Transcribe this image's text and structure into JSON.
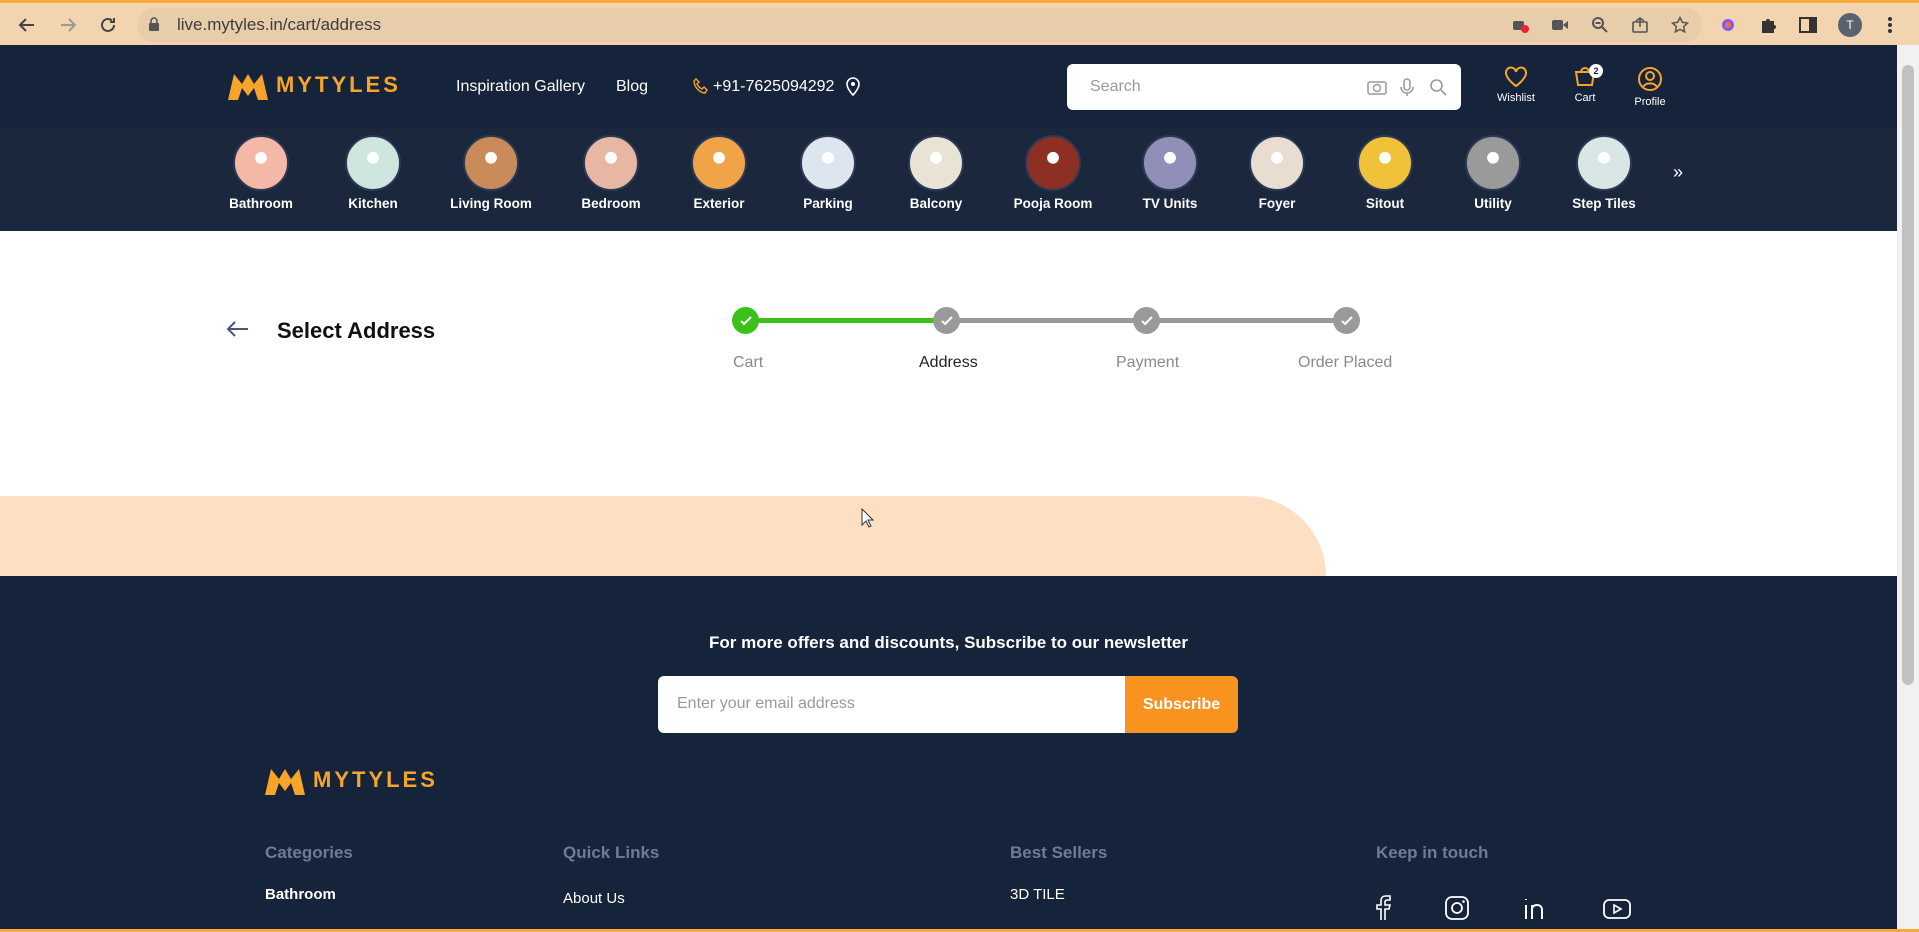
{
  "browser": {
    "url": "live.mytyles.in/cart/address",
    "profile_initial": "T"
  },
  "brand": {
    "name": "MYTYLES",
    "color": "#f7a52a"
  },
  "header": {
    "nav": {
      "inspiration": "Inspiration Gallery",
      "blog": "Blog",
      "phone": "+91-7625094292"
    },
    "search_placeholder": "Search",
    "wishlist": "Wishlist",
    "cart": "Cart",
    "cart_count": "2",
    "profile": "Profile"
  },
  "categories": [
    "Bathroom",
    "Kitchen",
    "Living Room",
    "Bedroom",
    "Exterior",
    "Parking",
    "Balcony",
    "Pooja Room",
    "TV Units",
    "Foyer",
    "Sitout",
    "Utility",
    "Step Tiles"
  ],
  "more_glyph": "»",
  "page": {
    "title": "Select Address",
    "steps": [
      "Cart",
      "Address",
      "Payment",
      "Order Placed"
    ]
  },
  "footer": {
    "newsletter": "For more offers and discounts, Subscribe to our newsletter",
    "email_placeholder": "Enter your email address",
    "subscribe": "Subscribe",
    "columns": {
      "categories": {
        "heading": "Categories",
        "first": "Bathroom"
      },
      "quick_links": {
        "heading": "Quick Links",
        "first": "About Us"
      },
      "best_sellers": {
        "heading": "Best Sellers",
        "first": "3D TILE"
      },
      "keep_in_touch": {
        "heading": "Keep in touch"
      }
    }
  },
  "colors": {
    "header_bg": "#15233b",
    "accent": "#f7931e",
    "step_done": "#3ac21b",
    "step_pending": "#9a9a9a",
    "peach": "#fde0c3"
  }
}
